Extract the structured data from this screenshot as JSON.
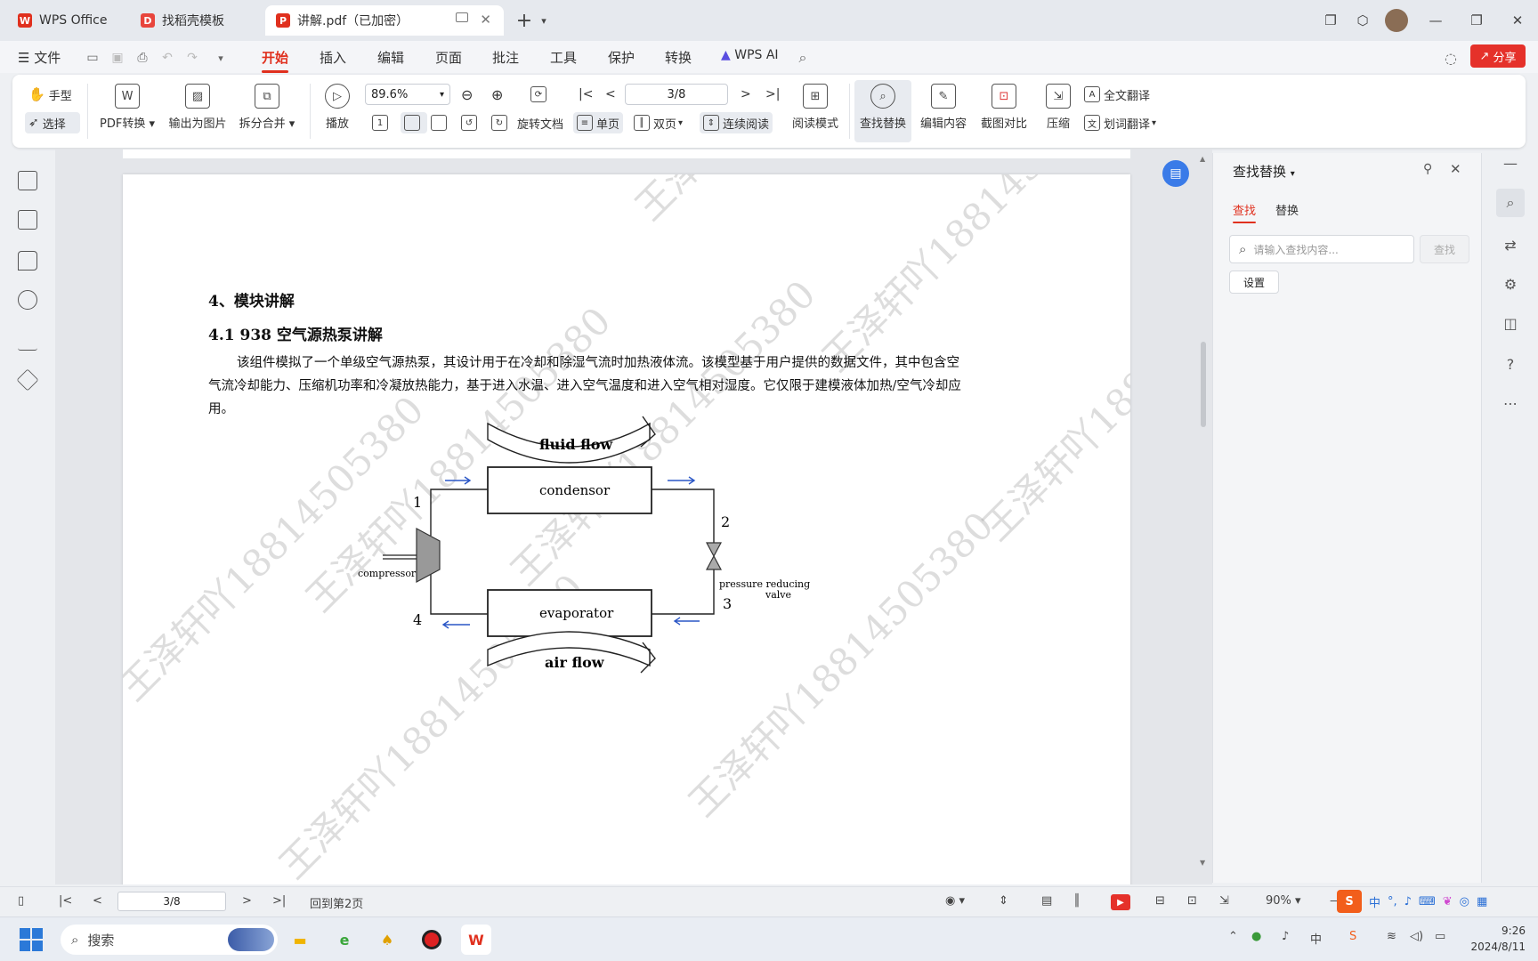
{
  "titlebar": {
    "tabs": [
      {
        "label": "WPS Office",
        "icon": "wps-logo-icon"
      },
      {
        "label": "找稻壳模板",
        "icon": "docer-icon"
      },
      {
        "label": "讲解.pdf（已加密）",
        "icon": "pdf-icon"
      }
    ],
    "new_tab": "+"
  },
  "menubar": {
    "file": "文件",
    "items": [
      "开始",
      "插入",
      "编辑",
      "页面",
      "批注",
      "工具",
      "保护",
      "转换"
    ],
    "active": "开始",
    "wps_ai": "WPS AI",
    "share": "分享"
  },
  "ribbon": {
    "hand": "手型",
    "select": "选择",
    "pdf_convert": "PDF转换",
    "export_image": "输出为图片",
    "split_merge": "拆分合并",
    "play": "播放",
    "zoom_value": "89.6%",
    "rotate": "旋转文档",
    "single": "单页",
    "double": "双页",
    "continuous": "连续阅读",
    "page_field": "3/8",
    "read_mode": "阅读模式",
    "find_replace": "查找替换",
    "edit_content": "编辑内容",
    "screenshot_compare": "截图对比",
    "compress": "压缩",
    "full_translate": "全文翻译",
    "word_translate": "划词翻译"
  },
  "document": {
    "heading1": "4、模块讲解",
    "heading2": "4.1 938 空气源热泵讲解",
    "para_line1": "该组件模拟了一个单级空气源热泵，其设计用于在冷却和除湿气流时加热液体流。该模型基于用户提供的数据文件，其中包含空",
    "para_line2": "气流冷却能力、压缩机功率和冷凝放热能力，基于进入水温、进入空气温度和进入空气相对湿度。它仅限于建模液体加热/空气冷却应",
    "para_line3": "用。",
    "watermark": "王泽轩吖18814505380",
    "diagram": {
      "fluid_flow": "fluid flow",
      "air_flow": "air flow",
      "condensor": "condensor",
      "evaporator": "evaporator",
      "compressor": "compressor",
      "valve_line1": "pressure reducing",
      "valve_line2": "valve",
      "n1": "1",
      "n2": "2",
      "n3": "3",
      "n4": "4"
    }
  },
  "find_panel": {
    "title": "查找替换",
    "tab_find": "查找",
    "tab_replace": "替换",
    "placeholder": "请输入查找内容...",
    "find_button": "查找",
    "settings": "设置"
  },
  "statusbar": {
    "page_field": "3/8",
    "back_to": "回到第2页",
    "zoom": "90%"
  },
  "taskbar": {
    "search": "搜索",
    "time": "9:26",
    "date": "2024/8/11",
    "ime": "中"
  },
  "colors": {
    "accent": "#e0301e",
    "share_bg": "#e5312a",
    "selected_bg": "#e8ebf0"
  }
}
